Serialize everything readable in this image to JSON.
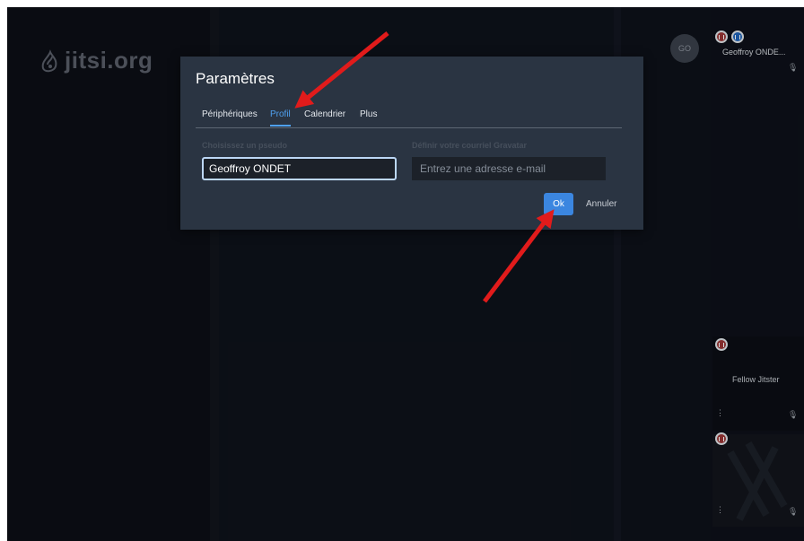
{
  "app": {
    "logo_text": "jitsi.org"
  },
  "dialog": {
    "title": "Paramètres",
    "tabs": [
      {
        "label": "Périphériques",
        "active": false
      },
      {
        "label": "Profil",
        "active": true
      },
      {
        "label": "Calendrier",
        "active": false
      },
      {
        "label": "Plus",
        "active": false
      }
    ],
    "name_field": {
      "label": "Choisissez un pseudo",
      "value": "Geoffroy ONDET"
    },
    "email_field": {
      "label": "Définir votre courriel Gravatar",
      "value": "",
      "placeholder": "Entrez une adresse e-mail"
    },
    "ok_label": "Ok",
    "cancel_label": "Annuler"
  },
  "filmstrip": {
    "local": {
      "initials": "GO",
      "name": "Geoffroy ONDE..."
    },
    "remote": [
      {
        "name": "Fellow Jitster"
      },
      {
        "name": ""
      }
    ]
  },
  "colors": {
    "accent": "#3b86e0",
    "dialog_bg": "#2a3442",
    "stage_bg": "#0d1019",
    "annotation_arrow": "#e11b1b",
    "indicator_red": "#9a3636",
    "indicator_blue": "#1f63ba"
  },
  "icons": {
    "connection": "signal-bars-icon",
    "dominant_speaker": "speaker-icon",
    "muted_mic": "mic-off-icon",
    "menu": "vertical-dots-icon",
    "logo": "jitsi-logo-icon"
  }
}
